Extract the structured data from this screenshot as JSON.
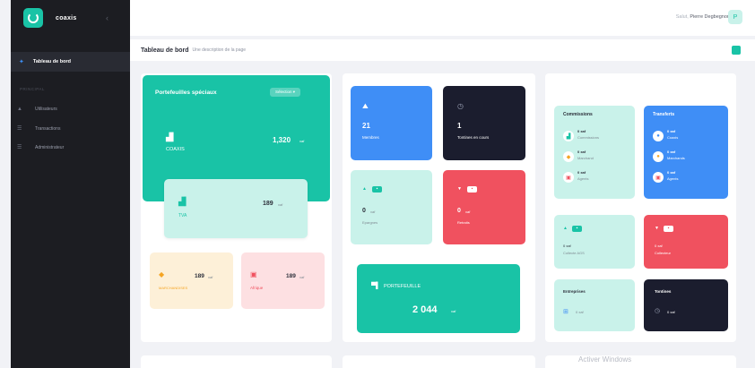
{
  "app": {
    "brand": "coaxis"
  },
  "sidebar": {
    "active_item": "Tableau de bord",
    "section_label": "PRINCIPAL",
    "items": [
      {
        "label": "Utilisateurs",
        "icon": "users-icon"
      },
      {
        "label": "Transactions",
        "icon": "list-icon"
      },
      {
        "label": "Administrateur",
        "icon": "admin-icon"
      }
    ]
  },
  "topbar": {
    "greeting": "Salut,",
    "user_name": "Pierre Degbegnon",
    "avatar_initial": "P"
  },
  "breadcrumb": {
    "title": "Tableau de bord",
    "subtitle": "Une description de la page"
  },
  "portfolio": {
    "title": "Portefeuilles spéciaux",
    "filter_label": "Sélection ▾",
    "main_label": "COAXIS",
    "main_value": "1,320",
    "main_unit": "xaf",
    "sub_label": "TVA",
    "sub_value": "189",
    "sub_unit": "xaf",
    "cell1_label": "MARCHANDISES",
    "cell1_value": "189",
    "cell1_unit": "xaf",
    "cell2_label": "Afrique",
    "cell2_value": "189",
    "cell2_unit": "xaf"
  },
  "stats": {
    "members_value": "21",
    "members_label": "Membres",
    "tontines_value": "1",
    "tontines_label": "Tontines en cours",
    "savings_value": "0",
    "savings_unit": "xaf",
    "savings_label": "Epargnes",
    "debts_value": "0",
    "debts_unit": "xaf",
    "debts_label": "Retraits",
    "wallet_label": "PORTEFEUILLE",
    "wallet_value": "2 044",
    "wallet_unit": "xaf"
  },
  "right": {
    "commissions_title": "Commissions",
    "commissions_items": [
      {
        "amount": "0 xaf",
        "label": "Commissions"
      },
      {
        "amount": "0 xaf",
        "label": "Marchand"
      },
      {
        "amount": "0 xaf",
        "label": "Agents"
      }
    ],
    "transfers_title": "Transferts",
    "transfers_items": [
      {
        "amount": "0 xaf",
        "label": "Coaxis"
      },
      {
        "amount": "0 xaf",
        "label": "Marchands"
      },
      {
        "amount": "0 xaf",
        "label": "Agents"
      }
    ],
    "collect_value": "0 xaf",
    "collect_label": "Collecte AGS",
    "collect2_value": "0 xaf",
    "collect2_label": "Collecteur",
    "entities_title": "Entreprises",
    "entities_value": "0 xaf",
    "tontines_title": "Tontines",
    "tontines_value": "0 xaf"
  },
  "watermark": "Activer Windows",
  "colors": {
    "teal": "#19c3a6",
    "mint": "#c9f2ea",
    "blue": "#3f8ef6",
    "navy": "#1b1d2e",
    "red": "#f0515f",
    "sidebar": "#1c1d22"
  }
}
